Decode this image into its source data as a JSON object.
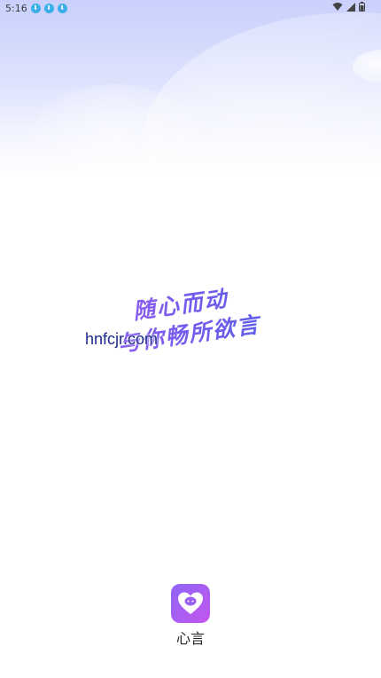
{
  "status_bar": {
    "time": "5:16",
    "notification_icons": [
      "download-icon",
      "download-icon",
      "download-icon"
    ],
    "right_icons": [
      "wifi-icon",
      "signal-icon",
      "battery-icon"
    ]
  },
  "slogan": {
    "line1": "随心而动",
    "line2": "与你畅所欲言"
  },
  "watermark": "hnfcjr.com",
  "app": {
    "name": "心言",
    "icon": "heart-chat-icon"
  },
  "colors": {
    "accent_start": "#8a5cf0",
    "accent_end": "#5a5de8",
    "icon_gradient_start": "#8e66f6",
    "icon_gradient_end": "#c456ee",
    "status_notification": "#3aaee8"
  }
}
